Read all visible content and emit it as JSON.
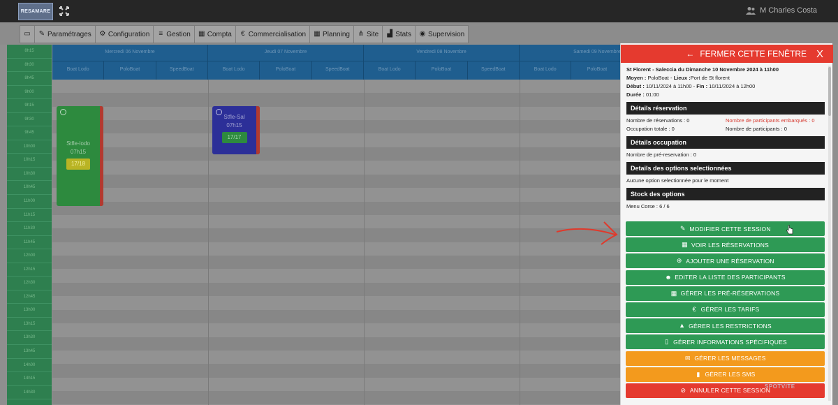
{
  "app": {
    "logo_text": "RESAMARE",
    "user_name": "M Charles Costa"
  },
  "nav": [
    {
      "label": "",
      "icon": "monitor-icon"
    },
    {
      "label": "Paramétrages",
      "icon": "wrench-icon"
    },
    {
      "label": "Configuration",
      "icon": "gears-icon"
    },
    {
      "label": "Gestion",
      "icon": "list-icon"
    },
    {
      "label": "Compta",
      "icon": "calculator-icon"
    },
    {
      "label": "Commercialisation",
      "icon": "euro-icon"
    },
    {
      "label": "Planning",
      "icon": "calendar-icon"
    },
    {
      "label": "Site",
      "icon": "sitemap-icon"
    },
    {
      "label": "Stats",
      "icon": "chart-icon"
    },
    {
      "label": "Supervision",
      "icon": "eye-icon"
    }
  ],
  "times": [
    "8h15",
    "8h30",
    "8h45",
    "9h00",
    "9h15",
    "9h30",
    "9h45",
    "10h00",
    "10h15",
    "10h30",
    "10h45",
    "11h00",
    "11h15",
    "11h30",
    "11h45",
    "12h00",
    "12h15",
    "12h30",
    "12h45",
    "13h00",
    "13h15",
    "13h30",
    "13h45",
    "14h00",
    "14h15",
    "14h30"
  ],
  "days": [
    {
      "title": "Mercredi 06 Novembre",
      "resources": [
        "Boat Lodo",
        "PoloBoat",
        "SpeedBoat"
      ]
    },
    {
      "title": "Jeudi 07 Novembre",
      "resources": [
        "Boat Lodo",
        "PoloBoat",
        "SpeedBoat"
      ]
    },
    {
      "title": "Vendredi 08 Novembre",
      "resources": [
        "Boat Lodo",
        "PoloBoat",
        "SpeedBoat"
      ]
    },
    {
      "title": "Samedi 09 Novembre",
      "resources": [
        "Boat Lodo",
        "PoloBoat",
        ""
      ]
    }
  ],
  "events": [
    {
      "name": "Stfle-lodo",
      "time": "07h15",
      "count": "17/18",
      "color": "#2d8a3e",
      "count_bg": "#b9b424",
      "count_color": "#f4f0a0"
    },
    {
      "name": "Stfle-Sal",
      "time": "07h15",
      "count": "17/17",
      "color": "#2c2f98",
      "count_bg": "#2d8a3e",
      "count_color": "#a7d8b0"
    }
  ],
  "panel": {
    "close_label": "FERMER CETTE FENÊTRE",
    "close_x": "X",
    "session_title": "St Florent - Saleccia du Dimanche 10 Novembre 2024 à 11h00",
    "moyen_label": "Moyen :",
    "moyen_value": "PoloBoat",
    "lieux_label": "Lieux :",
    "lieux_value": "Port de St florent",
    "debut_label": "Début :",
    "debut_value": "10/11/2024 à 11h00",
    "fin_label": "Fin :",
    "fin_value": "10/11/2024 à 12h00",
    "duree_label": "Durée :",
    "duree_value": "01:00",
    "details_reservation": "Détails réservation",
    "nb_reservations": "Nombre de réservations : 0",
    "nb_participants_embarques": "Nombre de participants embarqués : 0",
    "occupation_totale": "Occupation totale : 0",
    "nb_participants": "Nombre de participants : 0",
    "details_occupation": "Détails occupation",
    "nb_pre_reservation": "Nombre de pré-reservation : 0",
    "details_options": "Details des options selectionnées",
    "aucune_option": "Aucune option selectionnée pour le moment",
    "stock_options": "Stock des options",
    "menu_corse": "Menu Corse : 6 / 6"
  },
  "actions": [
    {
      "label": "MODIFIER CETTE SESSION",
      "icon": "edit-icon",
      "glyph": "✎",
      "color": "#2e9a55"
    },
    {
      "label": "VOIR LES RÉSERVATIONS",
      "icon": "calendar-check-icon",
      "glyph": "▦",
      "color": "#2e9a55"
    },
    {
      "label": "AJOUTER UNE RÉSERVATION",
      "icon": "plus-circle-icon",
      "glyph": "⊕",
      "color": "#2e9a55"
    },
    {
      "label": "EDITER LA LISTE DES PARTICIPANTS",
      "icon": "users-icon",
      "glyph": "☻",
      "color": "#2e9a55"
    },
    {
      "label": "GÉRER LES PRÉ-RÉSERVATIONS",
      "icon": "calendar-icon",
      "glyph": "▦",
      "color": "#2e9a55"
    },
    {
      "label": "GÉRER LES TARIFS",
      "icon": "euro-icon",
      "glyph": "€",
      "color": "#2e9a55"
    },
    {
      "label": "GÉRER LES RESTRICTIONS",
      "icon": "lock-icon",
      "glyph": "▲",
      "color": "#2e9a55"
    },
    {
      "label": "GÉRER INFORMATIONS SPÉCIFIQUES",
      "icon": "file-icon",
      "glyph": "▯",
      "color": "#2e9a55"
    },
    {
      "label": "GÉRER LES MESSAGES",
      "icon": "envelope-icon",
      "glyph": "✉",
      "color": "#f39a1d"
    },
    {
      "label": "GÉRER LES SMS",
      "icon": "mobile-icon",
      "glyph": "▮",
      "color": "#f39a1d"
    },
    {
      "label": "ANNULER CETTE SESSION",
      "icon": "ban-icon",
      "glyph": "⊘",
      "color": "#e53a2f"
    }
  ],
  "colors": {
    "accent_red": "#e53a2f",
    "action_green": "#2e9a55",
    "action_orange": "#f39a1d",
    "header_blue": "#1f5e8f",
    "time_green": "#2e7f4f"
  },
  "watermark": "SPOTVITE"
}
